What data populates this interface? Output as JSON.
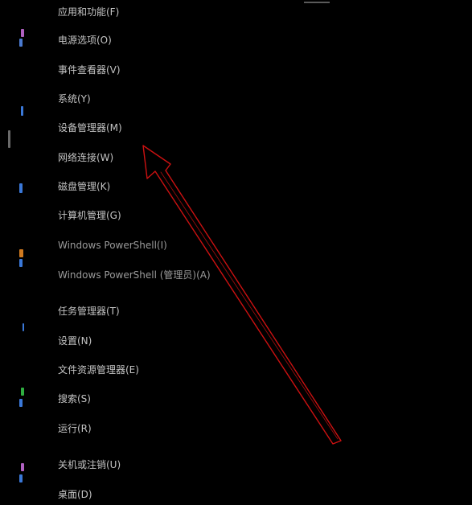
{
  "menu": {
    "items": [
      {
        "label": "应用和功能(F)"
      },
      {
        "label": "电源选项(O)"
      },
      {
        "label": "事件查看器(V)"
      },
      {
        "label": "系统(Y)"
      },
      {
        "label": "设备管理器(M)"
      },
      {
        "label": "网络连接(W)"
      },
      {
        "label": "磁盘管理(K)"
      },
      {
        "label": "计算机管理(G)"
      },
      {
        "label": "Windows PowerShell(I)"
      },
      {
        "label": "Windows PowerShell (管理员)(A)"
      },
      {
        "label": "任务管理器(T)"
      },
      {
        "label": "设置(N)"
      },
      {
        "label": "文件资源管理器(E)"
      },
      {
        "label": "搜索(S)"
      },
      {
        "label": "运行(R)"
      },
      {
        "label": "关机或注销(U)"
      },
      {
        "label": "桌面(D)"
      }
    ]
  },
  "annotation": {
    "arrow_color": "#cc1111",
    "points_to": "设备管理器(M)"
  },
  "colors": {
    "background": "#000000",
    "menu_text": "#c4c4c4"
  }
}
